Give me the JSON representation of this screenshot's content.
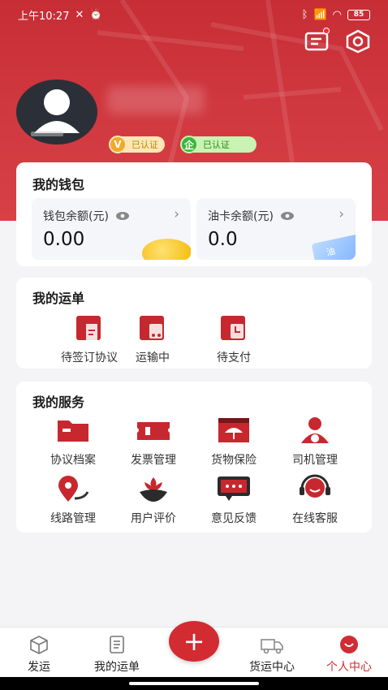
{
  "status_bar": {
    "time": "上午10:27",
    "battery": "85"
  },
  "header": {
    "message_icon": "message-icon",
    "settings_icon": "settings-icon"
  },
  "profile": {
    "badges": [
      {
        "icon_text": "V",
        "label": "已认证"
      },
      {
        "icon_text": "企",
        "label": "已认证"
      }
    ]
  },
  "wallet": {
    "title": "我的钱包",
    "balance_label": "钱包余额(元)",
    "balance_value": "0.00",
    "fuel_label": "油卡余额(元)",
    "fuel_value": "0.0",
    "fuel_card_text": "油"
  },
  "orders": {
    "title": "我的运单",
    "items": [
      {
        "label": "待签订协议",
        "icon": "contract-icon"
      },
      {
        "label": "运输中",
        "icon": "truck-icon"
      },
      {
        "label": "待支付",
        "icon": "clock-icon"
      }
    ]
  },
  "services": {
    "title": "我的服务",
    "items": [
      {
        "label": "协议档案",
        "icon": "folder-icon"
      },
      {
        "label": "发票管理",
        "icon": "ticket-icon"
      },
      {
        "label": "货物保险",
        "icon": "umbrella-icon"
      },
      {
        "label": "司机管理",
        "icon": "driver-icon"
      },
      {
        "label": "线路管理",
        "icon": "route-icon"
      },
      {
        "label": "用户评价",
        "icon": "flower-icon"
      },
      {
        "label": "意见反馈",
        "icon": "feedback-icon"
      },
      {
        "label": "在线客服",
        "icon": "headset-icon"
      }
    ]
  },
  "tabbar": {
    "tabs": [
      {
        "label": "发运",
        "icon": "box-icon"
      },
      {
        "label": "我的运单",
        "icon": "list-icon"
      },
      {
        "label": "货运中心",
        "icon": "truck-outline-icon"
      },
      {
        "label": "个人中心",
        "icon": "profile-icon"
      }
    ],
    "fab_label": "+",
    "active_color": "#cf2d33"
  },
  "colors": {
    "brand": "#d22b31",
    "background": "#f4f4f6"
  }
}
